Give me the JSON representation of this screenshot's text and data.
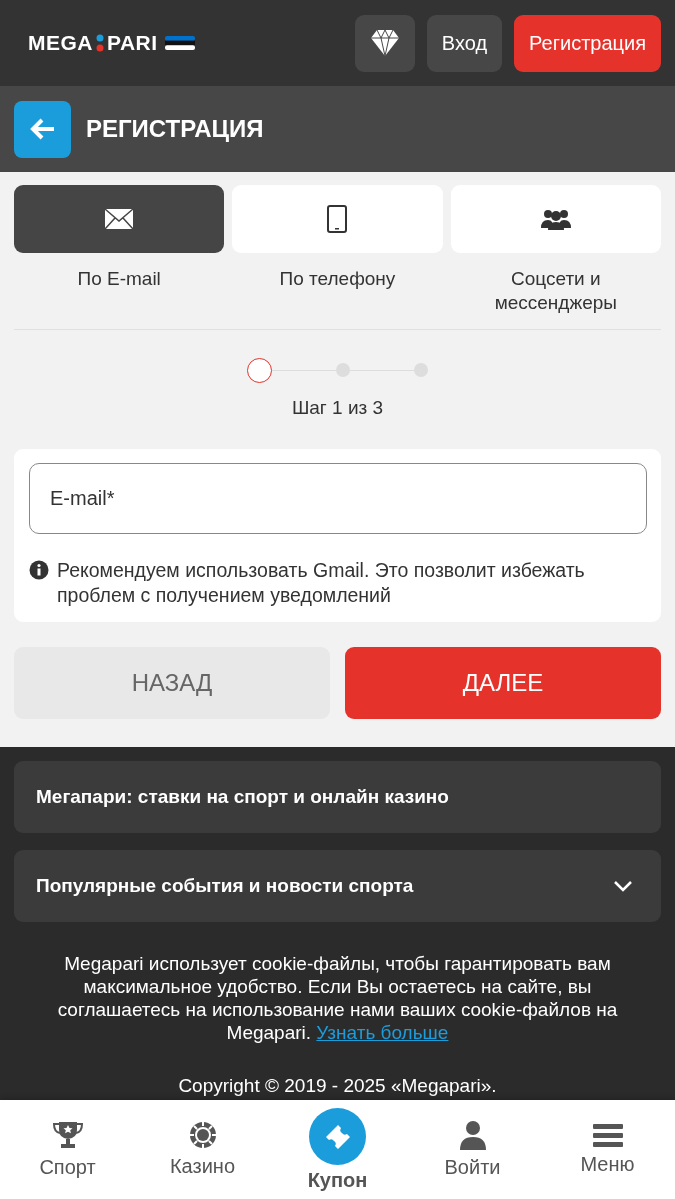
{
  "header": {
    "logo": {
      "left": "MEGA",
      "right": "PARI"
    },
    "login": "Вход",
    "register": "Регистрация"
  },
  "title_bar": {
    "title": "РЕГИСТРАЦИЯ"
  },
  "methods": [
    {
      "kind": "email",
      "label": "По E-mail",
      "selected": true
    },
    {
      "kind": "phone",
      "label": "По телефону",
      "selected": false
    },
    {
      "kind": "social",
      "label": "Соцсети и мессенджеры",
      "selected": false
    }
  ],
  "steps": [
    {
      "selected": true
    },
    {
      "selected": false
    },
    {
      "selected": false
    }
  ],
  "step_label": "Шаг 1 из 3",
  "form": {
    "email": {
      "placeholder": "E-mail*"
    },
    "hint": "Рекомендуем использовать Gmail. Это позволит избежать проблем с получением уведомлений"
  },
  "buttons": {
    "back": "НАЗАД",
    "next": "ДАЛЕЕ"
  },
  "footer": {
    "sections": [
      {
        "title": "Мегапари: ставки на спорт и онлайн казино",
        "expandable": false
      },
      {
        "title": "Популярные события и новости спорта",
        "expandable": true
      }
    ],
    "cookie_text": "Megapari использует cookie-файлы, чтобы гарантировать вам максимальное удобство. Если Вы остаетесь на сайте, вы соглашаетесь на использование нами ваших cookie-файлов на Megapari.",
    "cookie_link": "Узнать больше",
    "copyright": "Copyright © 2019 - 2025 «Megapari»."
  },
  "bottom_nav": [
    {
      "kind": "sport",
      "label": "Спорт",
      "selected": false
    },
    {
      "kind": "casino",
      "label": "Казино",
      "selected": false
    },
    {
      "kind": "coupon",
      "label": "Купон",
      "selected": true
    },
    {
      "kind": "login",
      "label": "Войти",
      "selected": false
    },
    {
      "kind": "menu",
      "label": "Меню",
      "selected": false
    }
  ]
}
